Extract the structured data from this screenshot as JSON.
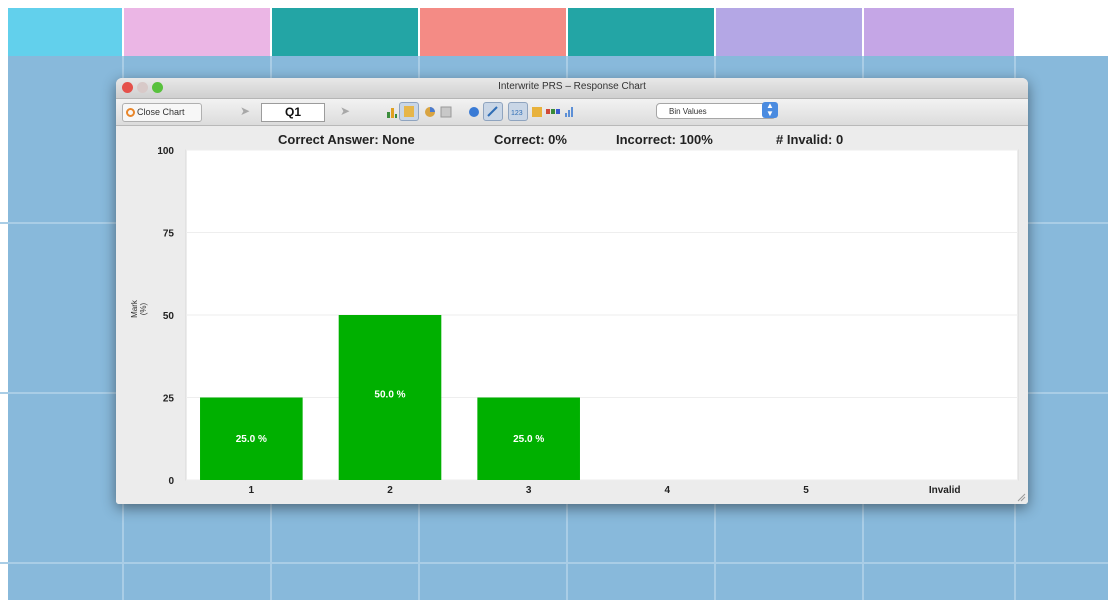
{
  "window": {
    "title": "Interwrite PRS – Response Chart"
  },
  "toolbar": {
    "close_chart_label": "Close Chart",
    "question_value": "Q1",
    "prev_icon": "left-arrow-icon",
    "next_icon": "right-arrow-icon",
    "display_select_value": "Bin Values"
  },
  "summary": {
    "correct_answer": "Correct Answer: None",
    "correct": "Correct: 0%",
    "incorrect": "Incorrect: 100%",
    "invalid": "# Invalid: 0"
  },
  "colors": {
    "bar": "#00b000",
    "window_bg": "#ececec",
    "grid_bg": "#88b9db"
  },
  "chart_data": {
    "type": "bar",
    "categories": [
      "1",
      "2",
      "3",
      "4",
      "5",
      "Invalid"
    ],
    "values": [
      25,
      50,
      25,
      0,
      0,
      0
    ],
    "data_labels": [
      "25.0 %",
      "50.0 %",
      "25.0 %",
      "",
      "",
      ""
    ],
    "ylabel": "Mark (%)",
    "ylim": [
      0,
      100
    ],
    "yticks": [
      "0",
      "25",
      "50",
      "75",
      "100"
    ],
    "grid": true
  }
}
